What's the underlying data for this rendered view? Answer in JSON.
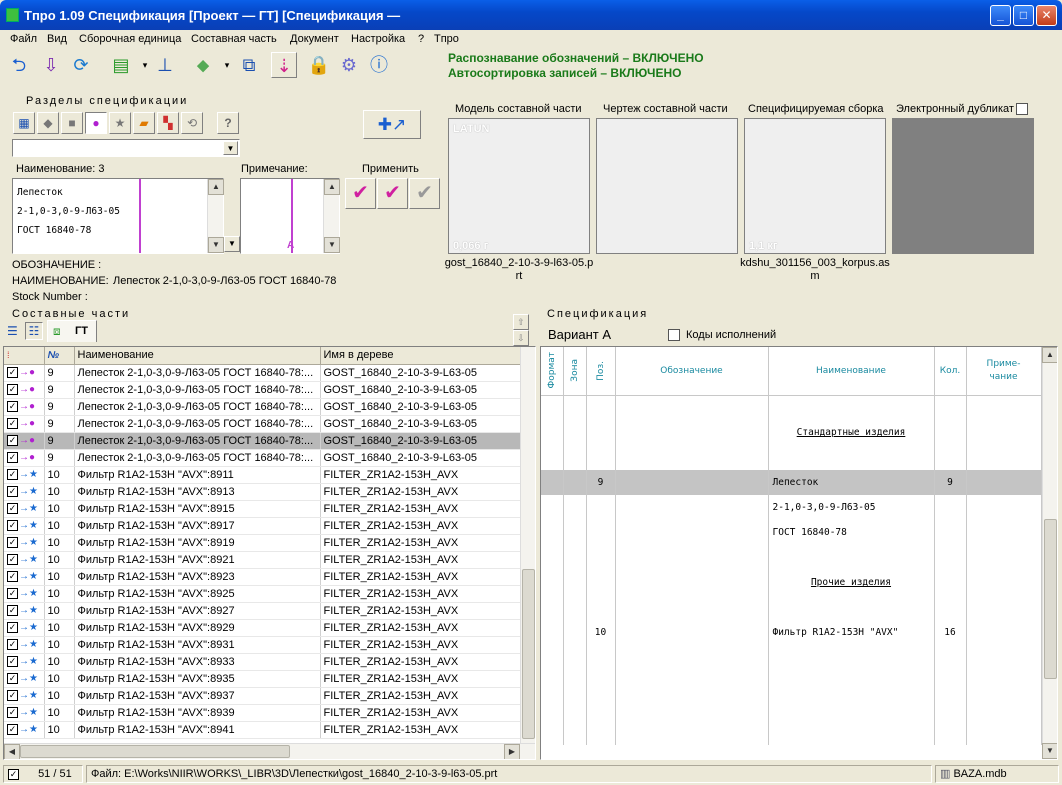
{
  "window": {
    "title": "Tпро 1.09 Спецификация   [Проект — ГТ] [Спецификация —"
  },
  "menu": [
    "Файл",
    "Вид",
    "Сборочная единица",
    "Составная часть",
    "Документ",
    "Настройка",
    "?",
    "Tпро"
  ],
  "notices": {
    "recognition": "Распознавание обозначений – ВКЛЮЧЕНО",
    "autosort": "Автосортировка записей – ВКЛЮЧЕНО"
  },
  "sections": {
    "title": "Разделы спецификации",
    "help": "?"
  },
  "name_field": {
    "label": "Наименование: 3",
    "lines": [
      "Лепесток",
      "2-1,0-3,0-9-Л63-05",
      "ГОСТ 16840-78"
    ]
  },
  "note_field": {
    "label": "Примечание:",
    "marker": "A"
  },
  "apply": {
    "label": "Применить"
  },
  "info": {
    "designation": "ОБОЗНАЧЕНИЕ :",
    "name_label": "НАИМЕНОВАНИЕ:",
    "name_value": "Лепесток 2-1,0-3,0-9-Л63-05 ГОСТ 16840-78",
    "stock": "Stock Number :"
  },
  "previews": {
    "model": {
      "label": "Модель составной части",
      "material": "LATUN",
      "mass": "0,066 г",
      "file": "gost_16840_2-10-3-9-l63-05.prt"
    },
    "drawing": {
      "label": "Чертеж составной части"
    },
    "assembly": {
      "label": "Специфицируемая сборка",
      "mass": "1,1 кг",
      "file": "kdshu_301156_003_korpus.asm"
    },
    "duplicate": {
      "label": "Электронный дубликат"
    }
  },
  "parts": {
    "title": "Составные части",
    "tab": "ГТ",
    "columns": {
      "pos_icon": "№",
      "name": "Наименование",
      "tree": "Имя в дереве"
    },
    "rows": [
      {
        "pos": "9",
        "name": "Лепесток 2-1,0-3,0-9-Л63-05 ГОСТ 16840-78:...",
        "tree": "GOST_16840_2-10-3-9-L63-05",
        "type": "petal"
      },
      {
        "pos": "9",
        "name": "Лепесток 2-1,0-3,0-9-Л63-05 ГОСТ 16840-78:...",
        "tree": "GOST_16840_2-10-3-9-L63-05",
        "type": "petal"
      },
      {
        "pos": "9",
        "name": "Лепесток 2-1,0-3,0-9-Л63-05 ГОСТ 16840-78:...",
        "tree": "GOST_16840_2-10-3-9-L63-05",
        "type": "petal"
      },
      {
        "pos": "9",
        "name": "Лепесток 2-1,0-3,0-9-Л63-05 ГОСТ 16840-78:...",
        "tree": "GOST_16840_2-10-3-9-L63-05",
        "type": "petal"
      },
      {
        "pos": "9",
        "name": "Лепесток 2-1,0-3,0-9-Л63-05 ГОСТ 16840-78:...",
        "tree": "GOST_16840_2-10-3-9-L63-05",
        "type": "petal",
        "selected": true
      },
      {
        "pos": "9",
        "name": "Лепесток 2-1,0-3,0-9-Л63-05 ГОСТ 16840-78:...",
        "tree": "GOST_16840_2-10-3-9-L63-05",
        "type": "petal"
      },
      {
        "pos": "10",
        "name": "Фильтр R1A2-153H \"AVX\":8911",
        "tree": "FILTER_ZR1A2-153H_AVX",
        "type": "filter"
      },
      {
        "pos": "10",
        "name": "Фильтр R1A2-153H \"AVX\":8913",
        "tree": "FILTER_ZR1A2-153H_AVX",
        "type": "filter"
      },
      {
        "pos": "10",
        "name": "Фильтр R1A2-153H \"AVX\":8915",
        "tree": "FILTER_ZR1A2-153H_AVX",
        "type": "filter"
      },
      {
        "pos": "10",
        "name": "Фильтр R1A2-153H \"AVX\":8917",
        "tree": "FILTER_ZR1A2-153H_AVX",
        "type": "filter"
      },
      {
        "pos": "10",
        "name": "Фильтр R1A2-153H \"AVX\":8919",
        "tree": "FILTER_ZR1A2-153H_AVX",
        "type": "filter"
      },
      {
        "pos": "10",
        "name": "Фильтр R1A2-153H \"AVX\":8921",
        "tree": "FILTER_ZR1A2-153H_AVX",
        "type": "filter"
      },
      {
        "pos": "10",
        "name": "Фильтр R1A2-153H \"AVX\":8923",
        "tree": "FILTER_ZR1A2-153H_AVX",
        "type": "filter"
      },
      {
        "pos": "10",
        "name": "Фильтр R1A2-153H \"AVX\":8925",
        "tree": "FILTER_ZR1A2-153H_AVX",
        "type": "filter"
      },
      {
        "pos": "10",
        "name": "Фильтр R1A2-153H \"AVX\":8927",
        "tree": "FILTER_ZR1A2-153H_AVX",
        "type": "filter"
      },
      {
        "pos": "10",
        "name": "Фильтр R1A2-153H \"AVX\":8929",
        "tree": "FILTER_ZR1A2-153H_AVX",
        "type": "filter"
      },
      {
        "pos": "10",
        "name": "Фильтр R1A2-153H \"AVX\":8931",
        "tree": "FILTER_ZR1A2-153H_AVX",
        "type": "filter"
      },
      {
        "pos": "10",
        "name": "Фильтр R1A2-153H \"AVX\":8933",
        "tree": "FILTER_ZR1A2-153H_AVX",
        "type": "filter"
      },
      {
        "pos": "10",
        "name": "Фильтр R1A2-153H \"AVX\":8935",
        "tree": "FILTER_ZR1A2-153H_AVX",
        "type": "filter"
      },
      {
        "pos": "10",
        "name": "Фильтр R1A2-153H \"AVX\":8937",
        "tree": "FILTER_ZR1A2-153H_AVX",
        "type": "filter"
      },
      {
        "pos": "10",
        "name": "Фильтр R1A2-153H \"AVX\":8939",
        "tree": "FILTER_ZR1A2-153H_AVX",
        "type": "filter"
      },
      {
        "pos": "10",
        "name": "Фильтр R1A2-153H \"AVX\":8941",
        "tree": "FILTER_ZR1A2-153H_AVX",
        "type": "filter"
      }
    ]
  },
  "spec": {
    "title": "Спецификация",
    "variant": "Вариант А",
    "codes_label": "Коды исполнений",
    "columns": {
      "format": "Формат",
      "zone": "Зона",
      "pos": "Поз.",
      "designation": "Обозначение",
      "name": "Наименование",
      "qty": "Кол.",
      "note1": "Приме-",
      "note2": "чание"
    },
    "rows": [
      {
        "pos": "",
        "name": "",
        "qty": ""
      },
      {
        "pos": "",
        "name": "Стандартные изделия",
        "qty": "",
        "heading": true
      },
      {
        "pos": "",
        "name": "",
        "qty": ""
      },
      {
        "pos": "9",
        "name": "Лепесток",
        "qty": "9",
        "selected": true
      },
      {
        "pos": "",
        "name": "2-1,0-3,0-9-Л63-05",
        "qty": ""
      },
      {
        "pos": "",
        "name": "ГОСТ 16840-78",
        "qty": ""
      },
      {
        "pos": "",
        "name": "",
        "qty": ""
      },
      {
        "pos": "",
        "name": "Прочие изделия",
        "qty": "",
        "heading": true
      },
      {
        "pos": "",
        "name": "",
        "qty": ""
      },
      {
        "pos": "10",
        "name": "Фильтр R1A2-153H \"AVX\"",
        "qty": "16"
      },
      {
        "pos": "",
        "name": "",
        "qty": ""
      },
      {
        "pos": "",
        "name": "",
        "qty": ""
      },
      {
        "pos": "",
        "name": "",
        "qty": ""
      },
      {
        "pos": "",
        "name": "",
        "qty": ""
      }
    ]
  },
  "status": {
    "count": "51 / 51",
    "file": "Файл: E:\\Works\\NIIR\\WORKS\\_LIBR\\3D\\Лепестки\\gost_16840_2-10-3-9-l63-05.prt",
    "db": "BAZA.mdb"
  }
}
